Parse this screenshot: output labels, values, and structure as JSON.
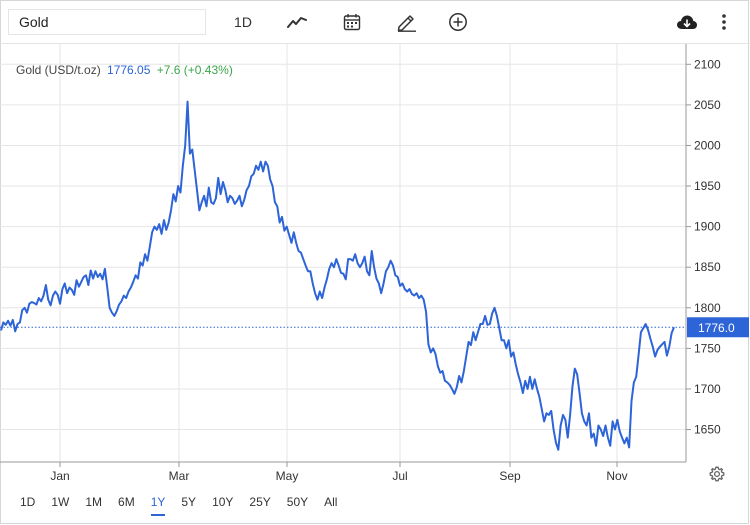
{
  "toolbar": {
    "symbol_value": "Gold",
    "interval_label": "1D",
    "icons": [
      "line-chart-icon",
      "calendar-icon",
      "draw-pencil-icon",
      "add-circle-icon",
      "cloud-download-icon",
      "more-vertical-icon"
    ]
  },
  "legend": {
    "name": "Gold (USD/t.oz)",
    "price": "1776.05",
    "change": "+7.6 (+0.43%)"
  },
  "colors": {
    "line": "#2d64d8",
    "grid": "#e6e6e6",
    "last_price_bg": "#2d64d8",
    "positive": "#3aa64a"
  },
  "ranges": [
    "1D",
    "1W",
    "1M",
    "6M",
    "1Y",
    "5Y",
    "10Y",
    "25Y",
    "50Y",
    "All"
  ],
  "active_range": "1Y",
  "chart_data": {
    "type": "line",
    "title": "",
    "xlabel": "",
    "ylabel": "",
    "x_ticks": [
      "Jan",
      "Mar",
      "May",
      "Jul",
      "Sep",
      "Nov"
    ],
    "y_ticks": [
      "2100",
      "2050",
      "2000",
      "1950",
      "1900",
      "1850",
      "1800",
      "1750",
      "1700",
      "1650"
    ],
    "ylim": [
      1610,
      2125
    ],
    "last_value": 1776.0,
    "last_value_label": "1776.0",
    "grid": true,
    "series": [
      {
        "values": [
          1772,
          1782,
          1779,
          1784,
          1778,
          1785,
          1771,
          1780,
          1782,
          1797,
          1800,
          1794,
          1805,
          1807,
          1806,
          1804,
          1812,
          1808,
          1815,
          1828,
          1810,
          1803,
          1815,
          1820,
          1816,
          1805,
          1823,
          1830,
          1818,
          1825,
          1822,
          1816,
          1834,
          1826,
          1832,
          1838,
          1840,
          1828,
          1846,
          1836,
          1845,
          1838,
          1842,
          1835,
          1848,
          1825,
          1800,
          1794,
          1790,
          1796,
          1804,
          1808,
          1815,
          1812,
          1820,
          1825,
          1832,
          1840,
          1836,
          1856,
          1852,
          1866,
          1858,
          1875,
          1893,
          1900,
          1896,
          1903,
          1891,
          1908,
          1896,
          1905,
          1920,
          1940,
          1931,
          1950,
          1942,
          1975,
          2000,
          2054,
          1990,
          1995,
          1970,
          1945,
          1920,
          1930,
          1938,
          1925,
          1948,
          1930,
          1928,
          1935,
          1960,
          1940,
          1955,
          1945,
          1930,
          1938,
          1935,
          1928,
          1932,
          1938,
          1925,
          1933,
          1945,
          1950,
          1962,
          1965,
          1975,
          1970,
          1980,
          1968,
          1980,
          1975,
          1958,
          1950,
          1930,
          1925,
          1905,
          1912,
          1895,
          1900,
          1890,
          1880,
          1893,
          1880,
          1870,
          1868,
          1860,
          1852,
          1845,
          1845,
          1830,
          1818,
          1810,
          1820,
          1812,
          1825,
          1835,
          1848,
          1855,
          1850,
          1860,
          1852,
          1843,
          1842,
          1835,
          1860,
          1860,
          1858,
          1866,
          1855,
          1850,
          1855,
          1863,
          1845,
          1840,
          1870,
          1850,
          1836,
          1830,
          1818,
          1830,
          1845,
          1850,
          1858,
          1852,
          1840,
          1838,
          1827,
          1830,
          1823,
          1820,
          1823,
          1817,
          1815,
          1818,
          1812,
          1815,
          1810,
          1795,
          1755,
          1745,
          1750,
          1743,
          1728,
          1720,
          1722,
          1710,
          1708,
          1705,
          1700,
          1694,
          1702,
          1716,
          1708,
          1722,
          1740,
          1758,
          1754,
          1770,
          1760,
          1770,
          1780,
          1780,
          1790,
          1779,
          1780,
          1793,
          1800,
          1790,
          1775,
          1760,
          1760,
          1750,
          1760,
          1740,
          1745,
          1730,
          1718,
          1708,
          1695,
          1710,
          1700,
          1715,
          1700,
          1712,
          1700,
          1690,
          1675,
          1660,
          1670,
          1668,
          1673,
          1650,
          1634,
          1625,
          1655,
          1668,
          1662,
          1640,
          1668,
          1703,
          1725,
          1718,
          1695,
          1670,
          1660,
          1655,
          1670,
          1640,
          1645,
          1630,
          1655,
          1650,
          1642,
          1655,
          1640,
          1630,
          1660,
          1650,
          1662,
          1648,
          1640,
          1633,
          1640,
          1628,
          1685,
          1708,
          1715,
          1742,
          1770,
          1775,
          1780,
          1773,
          1762,
          1752,
          1740,
          1748,
          1752,
          1755,
          1758,
          1741,
          1752,
          1769,
          1776
        ]
      }
    ]
  }
}
